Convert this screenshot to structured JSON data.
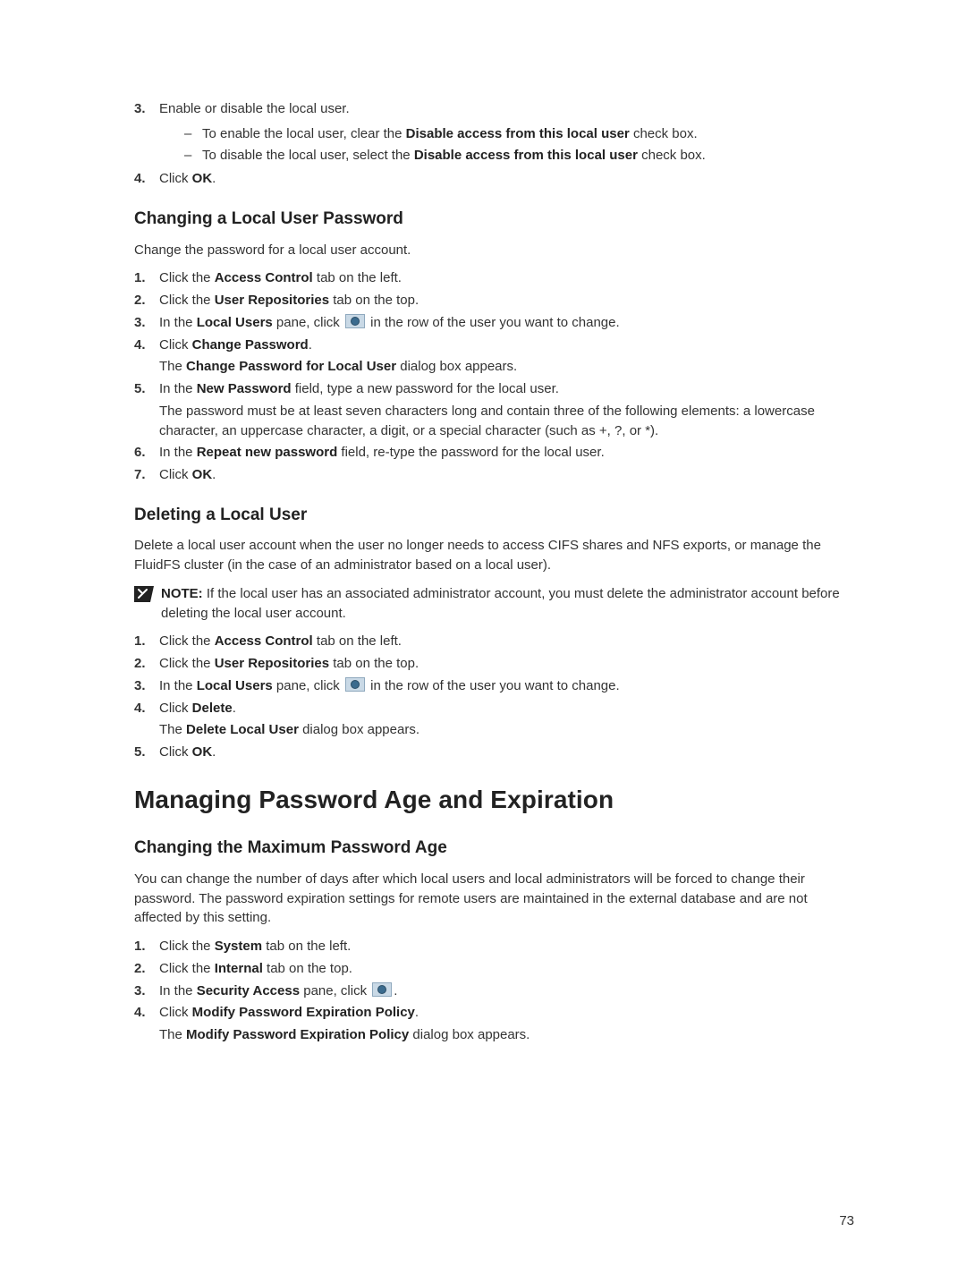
{
  "page_number": "73",
  "top_list": {
    "item3": {
      "num": "3.",
      "text": "Enable or disable the local user.",
      "sub_a_pre": "To enable the local user, clear the ",
      "sub_a_bold": "Disable access from this local user",
      "sub_a_post": " check box.",
      "sub_b_pre": "To disable the local user, select the ",
      "sub_b_bold": "Disable access from this local user",
      "sub_b_post": " check box."
    },
    "item4": {
      "num": "4.",
      "pre": "Click ",
      "bold": "OK",
      "post": "."
    }
  },
  "changing_pw": {
    "heading": "Changing a Local User Password",
    "intro": "Change the password for a local user account.",
    "s1": {
      "num": "1.",
      "pre": "Click the ",
      "bold": "Access Control",
      "post": " tab on the left."
    },
    "s2": {
      "num": "2.",
      "pre": "Click the ",
      "bold": "User Repositories",
      "post": " tab on the top."
    },
    "s3": {
      "num": "3.",
      "pre": "In the ",
      "bold": "Local Users",
      "mid": " pane, click ",
      "post": " in the row of the user you want to change."
    },
    "s4": {
      "num": "4.",
      "pre": "Click ",
      "bold": "Change Password",
      "post": ".",
      "sub_pre": "The ",
      "sub_bold": "Change Password for Local User",
      "sub_post": " dialog box appears."
    },
    "s5": {
      "num": "5.",
      "pre": "In the ",
      "bold": "New Password",
      "post": " field, type a new password for the local user.",
      "sub": "The password must be at least seven characters long and contain three of the following elements: a lowercase character, an uppercase character, a digit, or a special character (such as +, ?, or *)."
    },
    "s6": {
      "num": "6.",
      "pre": "In the ",
      "bold": "Repeat new password",
      "post": " field, re-type the password for the local user."
    },
    "s7": {
      "num": "7.",
      "pre": "Click ",
      "bold": "OK",
      "post": "."
    }
  },
  "deleting": {
    "heading": "Deleting a Local User",
    "intro": "Delete a local user account when the user no longer needs to access CIFS shares and NFS exports, or manage the FluidFS cluster (in the case of an administrator based on a local user).",
    "note_label": "NOTE:",
    "note_text": " If the local user has an associated administrator account, you must delete the administrator account before deleting the local user account.",
    "s1": {
      "num": "1.",
      "pre": "Click the ",
      "bold": "Access Control",
      "post": " tab on the left."
    },
    "s2": {
      "num": "2.",
      "pre": "Click the ",
      "bold": "User Repositories",
      "post": " tab on the top."
    },
    "s3": {
      "num": "3.",
      "pre": "In the ",
      "bold": "Local Users",
      "mid": " pane, click ",
      "post": " in the row of the user you want to change."
    },
    "s4": {
      "num": "4.",
      "pre": "Click ",
      "bold": "Delete",
      "post": ".",
      "sub_pre": "The ",
      "sub_bold": "Delete Local User",
      "sub_post": " dialog box appears."
    },
    "s5": {
      "num": "5.",
      "pre": "Click ",
      "bold": "OK",
      "post": "."
    }
  },
  "managing": {
    "heading": "Managing Password Age and Expiration",
    "sub_heading": "Changing the Maximum Password Age",
    "intro": "You can change the number of days after which local users and local administrators will be forced to change their password. The password expiration settings for remote users are maintained in the external database and are not affected by this setting.",
    "s1": {
      "num": "1.",
      "pre": "Click the ",
      "bold": "System",
      "post": " tab on the left."
    },
    "s2": {
      "num": "2.",
      "pre": "Click the ",
      "bold": "Internal",
      "post": " tab on the top."
    },
    "s3": {
      "num": "3.",
      "pre": "In the ",
      "bold": "Security Access",
      "mid": " pane, click ",
      "post": "."
    },
    "s4": {
      "num": "4.",
      "pre": "Click ",
      "bold": "Modify Password Expiration Policy",
      "post": ".",
      "sub_pre": "The ",
      "sub_bold": "Modify Password Expiration Policy",
      "sub_post": " dialog box appears."
    }
  }
}
